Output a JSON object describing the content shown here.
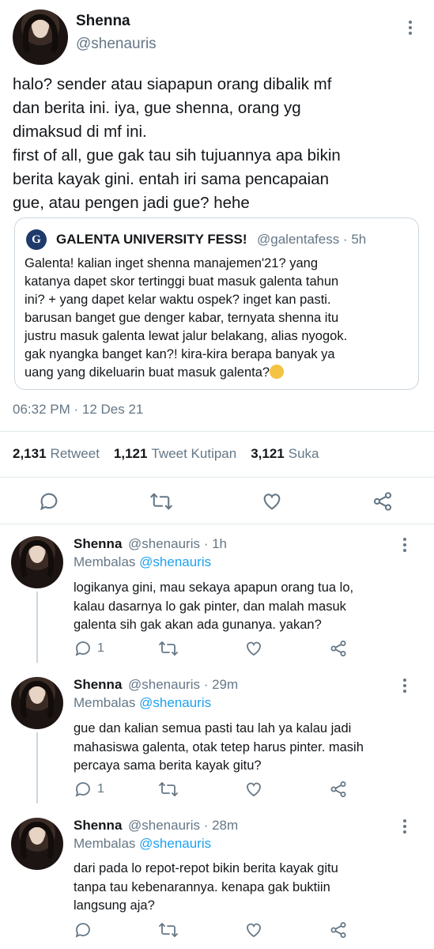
{
  "tweet": {
    "name": "Shenna",
    "handle": "@shenauris",
    "text": "halo? sender atau siapapun orang dibalik mf\ndan berita ini. iya, gue shenna, orang yg\ndimaksud di mf ini.\nfirst of all, gue gak tau sih tujuannya apa bikin\nberita kayak gini. entah iri sama pencapaian\ngue, atau pengen jadi gue? hehe",
    "timestamp": "06:32 PM · 12 Des 21"
  },
  "quote": {
    "logo_letter": "G",
    "name": "GALENTA UNIVERSITY FESS!",
    "handle": "@galentafess · 5h",
    "text": "Galenta! kalian inget shenna manajemen'21? yang\nkatanya dapet skor tertinggi buat masuk galenta tahun\nini? + yang dapet kelar waktu ospek? inget kan pasti.\nbarusan banget gue denger kabar, ternyata shenna itu\njustru masuk galenta lewat jalur belakang, alias nyogok.\ngak nyangka banget kan?! kira-kira berapa banyak ya\nuang yang dikeluarin buat masuk galenta?",
    "emoji": "thinking-face"
  },
  "stats": {
    "retweets": "2,131",
    "retweets_label": "Retweet",
    "quotes": "1,121",
    "quotes_label": "Tweet Kutipan",
    "likes": "3,121",
    "likes_label": "Suka"
  },
  "icons": {
    "reply": "reply-icon",
    "retweet": "retweet-icon",
    "like": "heart-icon",
    "share": "share-icon",
    "more": "more-icon"
  },
  "colors": {
    "text": "#14171a",
    "secondary": "#657786",
    "accent": "#1da1f2",
    "border": "#e1e8ed"
  },
  "replies": [
    {
      "name": "Shenna",
      "meta": "@shenauris · 1h",
      "replying_label": "Membalas",
      "replying_to": "@shenauris",
      "text": "logikanya gini, mau sekaya apapun orang tua lo,\nkalau dasarnya lo gak pinter, dan malah masuk\ngalenta sih gak akan ada gunanya. yakan?",
      "reply_count": "1"
    },
    {
      "name": "Shenna",
      "meta": "@shenauris · 29m",
      "replying_label": "Membalas",
      "replying_to": "@shenauris",
      "text": "gue dan kalian semua pasti tau lah ya kalau jadi\nmahasiswa galenta, otak tetep harus pinter. masih\npercaya sama berita kayak gitu?",
      "reply_count": "1"
    },
    {
      "name": "Shenna",
      "meta": "@shenauris · 28m",
      "replying_label": "Membalas",
      "replying_to": "@shenauris",
      "text": "dari pada lo repot-repot bikin berita kayak gitu\ntanpa tau kebenarannya. kenapa gak buktiin\nlangsung aja?",
      "reply_count": ""
    }
  ]
}
